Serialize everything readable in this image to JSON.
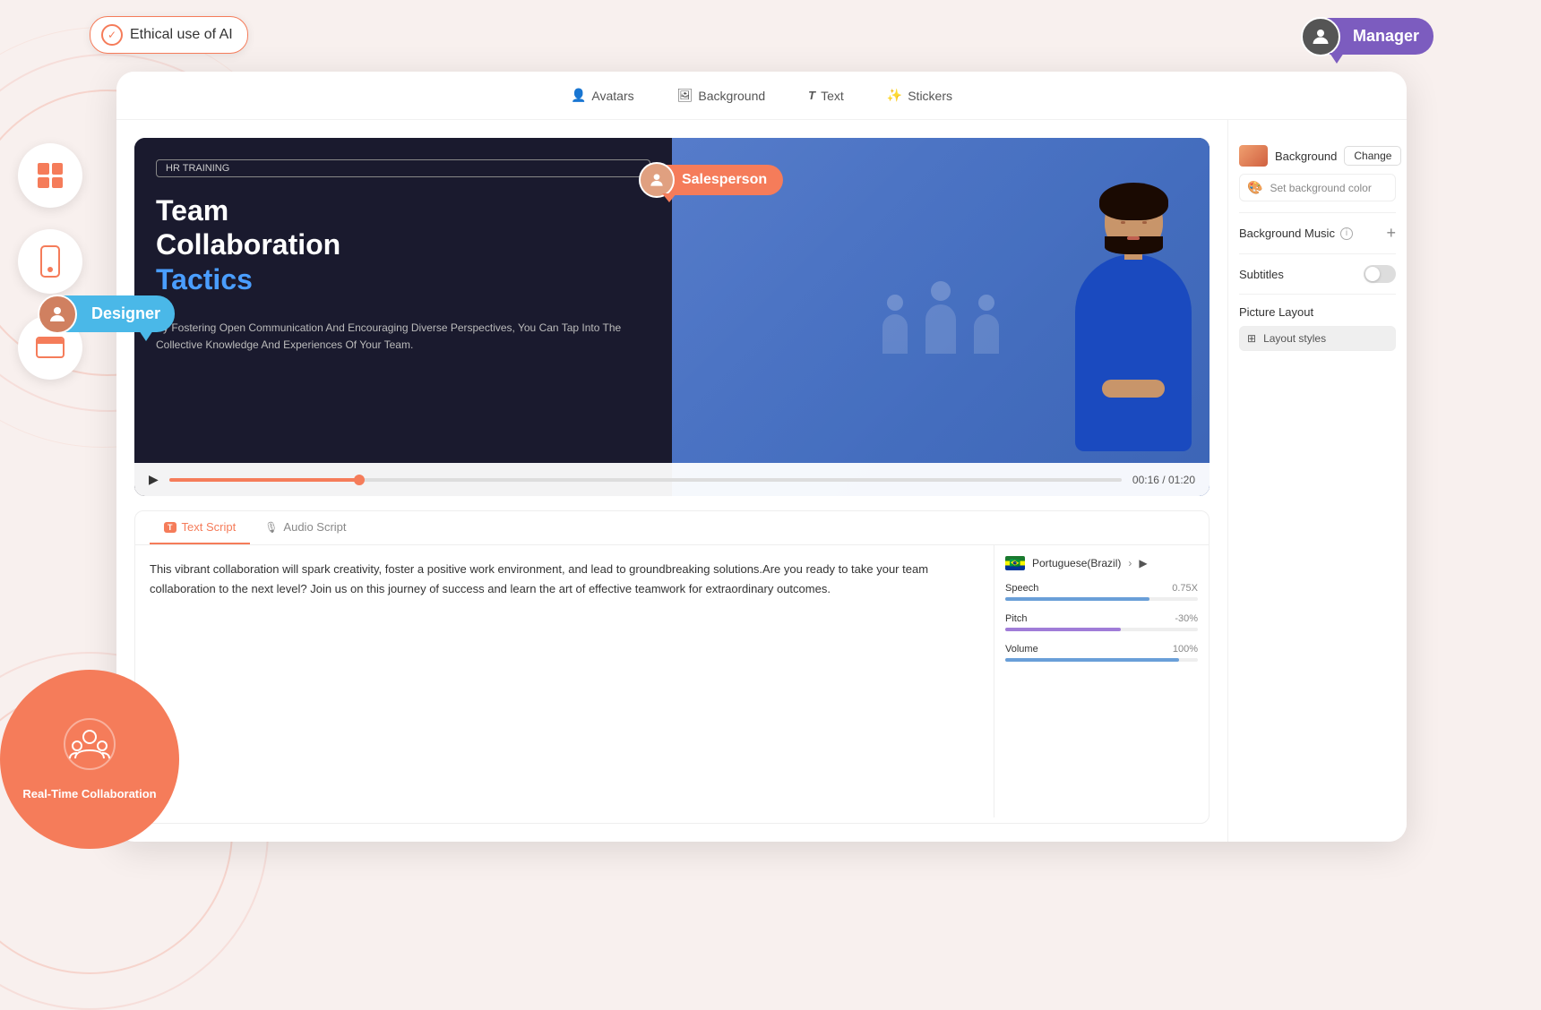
{
  "app": {
    "ethical_badge": "Ethical use of AI",
    "manager_label": "Manager",
    "designer_label": "Designer"
  },
  "nav": {
    "items": [
      {
        "label": "Avatars",
        "icon": "👤"
      },
      {
        "label": "Background",
        "icon": "🖼"
      },
      {
        "label": "Text",
        "icon": "T"
      },
      {
        "label": "Stickers",
        "icon": "✨"
      }
    ]
  },
  "video": {
    "hr_badge": "HR TRAINING",
    "title_line1": "Team",
    "title_line2": "Collaboration",
    "title_highlighted": "Tactics",
    "subtitle": "By Fostering Open Communication And Encouraging Diverse Perspectives, You Can Tap Into The Collective Knowledge And Experiences Of Your Team.",
    "salesperson_label": "Salesperson",
    "time_current": "00:16",
    "time_total": "01:20",
    "progress_percent": "20"
  },
  "script": {
    "tab_text": "Text Script",
    "tab_audio": "Audio Script",
    "body": "This vibrant collaboration will spark creativity, foster a positive work environment, and lead to groundbreaking solutions.Are you ready to take your team collaboration to the next level? Join us on this journey of success and learn the art of effective teamwork for extraordinary outcomes.",
    "language": "Portuguese(Brazil)",
    "speech_label": "Speech",
    "speech_value": "0.75X",
    "pitch_label": "Pitch",
    "pitch_value": "-30%",
    "volume_label": "Volume",
    "volume_value": "100%"
  },
  "right_panel": {
    "background_label": "Background",
    "change_btn": "Change",
    "set_bg_color": "Set background color",
    "bg_music_label": "Background Music",
    "subtitles_label": "Subtitles",
    "picture_layout_label": "Picture Layout",
    "layout_styles_btn": "Layout styles"
  },
  "left_icons": [
    {
      "name": "windows-icon"
    },
    {
      "name": "mobile-icon"
    },
    {
      "name": "browser-icon"
    }
  ],
  "collab": {
    "label": "Real-Time Collaboration"
  }
}
